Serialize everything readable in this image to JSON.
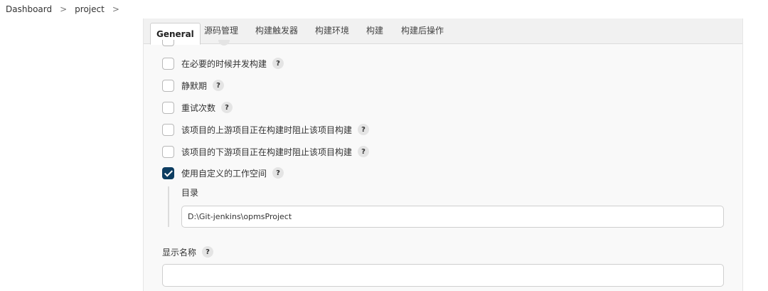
{
  "breadcrumb": {
    "items": [
      "Dashboard",
      "project"
    ],
    "separator": ">"
  },
  "tabs": [
    {
      "label": "General",
      "active": true
    },
    {
      "label": "源码管理",
      "active": false
    },
    {
      "label": "构建触发器",
      "active": false
    },
    {
      "label": "构建环境",
      "active": false
    },
    {
      "label": "构建",
      "active": false
    },
    {
      "label": "构建后操作",
      "active": false
    }
  ],
  "options": [
    {
      "label": "在必要的时候并发构建",
      "checked": false
    },
    {
      "label": "静默期",
      "checked": false
    },
    {
      "label": "重试次数",
      "checked": false
    },
    {
      "label": "该项目的上游项目正在构建时阻止该项目构建",
      "checked": false
    },
    {
      "label": "该项目的下游项目正在构建时阻止该项目构建",
      "checked": false
    },
    {
      "label": "使用自定义的工作空间",
      "checked": true
    }
  ],
  "custom_workspace": {
    "directory_label": "目录",
    "directory_value": "D:\\Git-jenkins\\opmsProject"
  },
  "display_name": {
    "label": "显示名称",
    "value": ""
  },
  "help_glyph": "?",
  "colors": {
    "checked_bg": "#0d3d61",
    "content_bg": "#f9f9f9",
    "tab_bar_bg": "#f1f1f1"
  }
}
